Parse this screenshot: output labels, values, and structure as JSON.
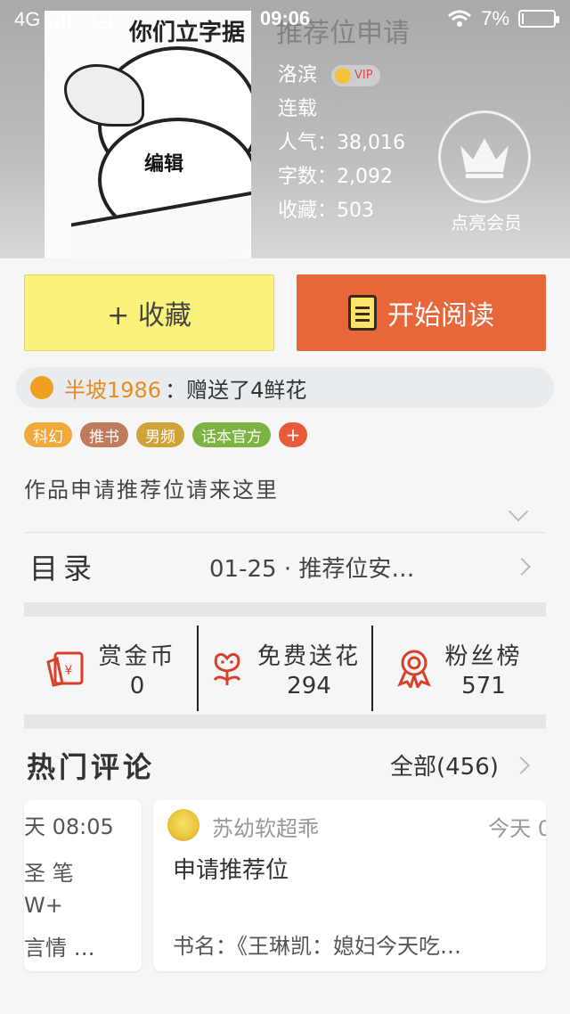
{
  "status": {
    "network": "4G",
    "time": "09:06",
    "battery": "7%",
    "battery_level": 0.07,
    "sim_icon": "S"
  },
  "book": {
    "cover_caption": "你们立字据",
    "cover_edit": "编辑",
    "ghost_title": "推荐位申请",
    "author": "洛滨",
    "vip": "VIP",
    "status": "连载",
    "popularity": "人气：38,016",
    "words": "字数：2,092",
    "favorites": "收藏：503",
    "member_label": "点亮会员"
  },
  "actions": {
    "favorite": "+ 收藏",
    "read": "开始阅读"
  },
  "gift": {
    "user": "半坡1986",
    "text": "：赠送了4鲜花"
  },
  "tags": [
    {
      "label": "科幻",
      "color": "#f1a93b"
    },
    {
      "label": "推书",
      "color": "#c07a5c"
    },
    {
      "label": "男频",
      "color": "#d0a339"
    },
    {
      "label": "话本官方",
      "color": "#7cb342"
    }
  ],
  "tag_add": "+",
  "description": "作品申请推荐位请来这里",
  "catalog": {
    "title": "目录",
    "latest": "01-25 · 推荐位安…"
  },
  "stats": [
    {
      "label": "赏金币",
      "value": "0",
      "icon": "red-envelope-icon"
    },
    {
      "label": "免费送花",
      "value": "294",
      "icon": "flower-icon"
    },
    {
      "label": "粉丝榜",
      "value": "571",
      "icon": "ribbon-icon"
    }
  ],
  "comments_section": {
    "title": "热门评论",
    "all": "全部(456)"
  },
  "comment1": {
    "time": "天 08:05",
    "line1": "圣  笔",
    "line2": "W+",
    "line3": "言情  …"
  },
  "comment2": {
    "user": "苏幼软超乖",
    "time": "今天 0",
    "body": "申请推荐位",
    "book": "书名：《王琳凯：媳妇今天吃…"
  },
  "colors": {
    "accent": "#e8673a",
    "favorite_bg": "#fbf27b",
    "highlight": "#ea8a1f"
  }
}
